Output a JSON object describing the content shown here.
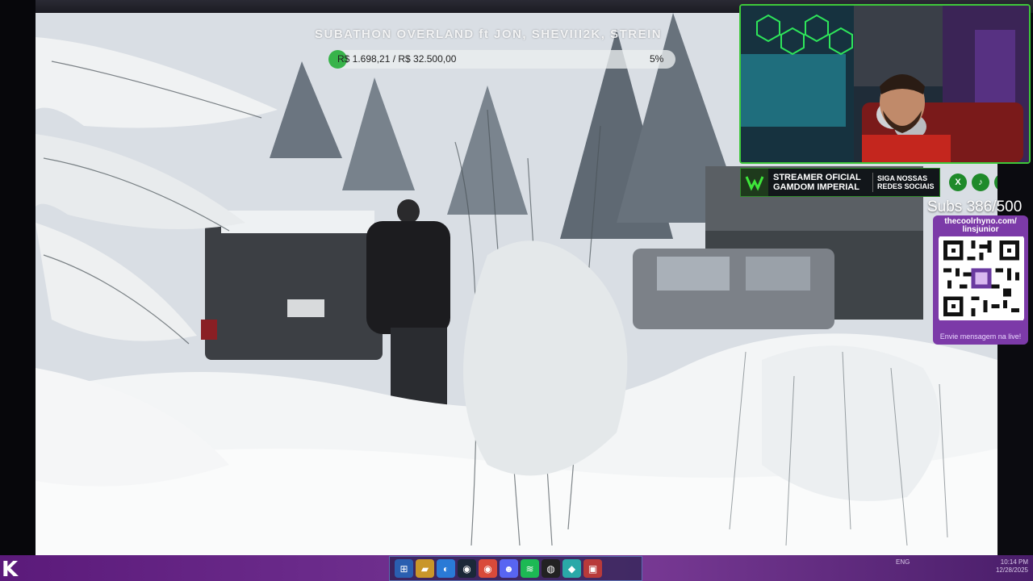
{
  "stream": {
    "subathon_title": "SUBATHON OVERLAND ft JON, SHEVIII2K, STREIN",
    "goal_text": "R$ 1.698,21 / R$ 32.500,00",
    "goal_percent_label": "5%",
    "goal_progress_fraction": 0.05,
    "subs_label": "Subs 386/500",
    "accent_color": "#38b34a"
  },
  "banner": {
    "main_text": "STREAMER OFICIAL GAMDOM IMPERIAL",
    "side_text": "SIGA NOSSAS REDES SOCIAIS",
    "logo_icon": "gamdom-logo-icon"
  },
  "socials": [
    {
      "name": "x-icon",
      "glyph": "X"
    },
    {
      "name": "tiktok-icon",
      "glyph": "♪"
    },
    {
      "name": "youtube-icon",
      "glyph": "▶"
    },
    {
      "name": "instagram-icon",
      "glyph": "◎"
    }
  ],
  "qr": {
    "url": "thecoolrhyno.com/ linsjunior",
    "caption": "Envie mensagem na live!",
    "card_color": "#7c3aa8"
  },
  "taskbar": {
    "logo": "K",
    "icons": [
      {
        "name": "windows-start-icon",
        "glyph": "⊞",
        "color": "#3a8ee6"
      },
      {
        "name": "file-explorer-icon",
        "glyph": "▰",
        "color": "#e6b83a"
      },
      {
        "name": "edge-icon",
        "glyph": "◐",
        "color": "#2a7ad6"
      },
      {
        "name": "steam-icon",
        "glyph": "◉",
        "color": "#1b2838"
      },
      {
        "name": "chrome-icon",
        "glyph": "◉",
        "color": "#d94a3a"
      },
      {
        "name": "discord-icon",
        "glyph": "☻",
        "color": "#5865f2"
      },
      {
        "name": "spotify-icon",
        "glyph": "≋",
        "color": "#1db954"
      },
      {
        "name": "obs-icon",
        "glyph": "◍",
        "color": "#222"
      },
      {
        "name": "app-icon",
        "glyph": "◆",
        "color": "#2aa8a8"
      },
      {
        "name": "stream-app-icon",
        "glyph": "▣",
        "color": "#b83a3a"
      }
    ],
    "tray_lang": "ENG",
    "clock_time": "10:14 PM",
    "clock_date": "12/28/2025"
  }
}
